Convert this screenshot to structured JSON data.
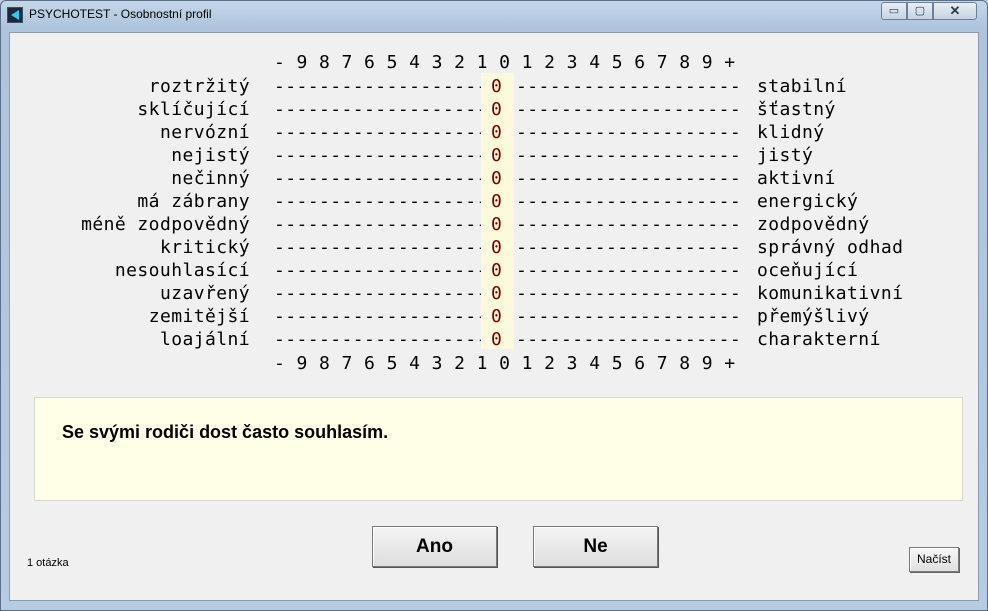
{
  "window": {
    "title": "PSYCHOTEST - Osobnostní profil",
    "controls": {
      "minimize": "▭",
      "maximize": "▢",
      "close": "✕"
    }
  },
  "scale": {
    "top": "- 9 8 7 6 5 4 3 2 1 0 1 2 3 4 5 6 7 8 9 +",
    "bottom": "- 9 8 7 6 5 4 3 2 1 0 1 2 3 4 5 6 7 8 9 +"
  },
  "rows": [
    {
      "left": "roztržitý",
      "dashes_left": "--------------------",
      "value": "0",
      "dashes_right": "--------------------",
      "right": "stabilní"
    },
    {
      "left": "sklíčující",
      "dashes_left": "--------------------",
      "value": "0",
      "dashes_right": "--------------------",
      "right": "šťastný"
    },
    {
      "left": "nervózní",
      "dashes_left": "--------------------",
      "value": "0",
      "dashes_right": "--------------------",
      "right": "klidný"
    },
    {
      "left": "nejistý",
      "dashes_left": "--------------------",
      "value": "0",
      "dashes_right": "--------------------",
      "right": "jistý"
    },
    {
      "left": "nečinný",
      "dashes_left": "--------------------",
      "value": "0",
      "dashes_right": "--------------------",
      "right": "aktivní"
    },
    {
      "left": "má zábrany",
      "dashes_left": "--------------------",
      "value": "0",
      "dashes_right": "--------------------",
      "right": "energický"
    },
    {
      "left": "méně zodpovědný",
      "dashes_left": "--------------------",
      "value": "0",
      "dashes_right": "--------------------",
      "right": "zodpovědný"
    },
    {
      "left": "kritický",
      "dashes_left": "--------------------",
      "value": "0",
      "dashes_right": "--------------------",
      "right": "správný odhad"
    },
    {
      "left": "nesouhlasící",
      "dashes_left": "--------------------",
      "value": "0",
      "dashes_right": "--------------------",
      "right": "oceňující"
    },
    {
      "left": "uzavřený",
      "dashes_left": "--------------------",
      "value": "0",
      "dashes_right": "--------------------",
      "right": "komunikativní"
    },
    {
      "left": "zemitější",
      "dashes_left": "--------------------",
      "value": "0",
      "dashes_right": "--------------------",
      "right": "přemýšlivý"
    },
    {
      "left": "loajální",
      "dashes_left": "--------------------",
      "value": "0",
      "dashes_right": "--------------------",
      "right": "charakterní"
    }
  ],
  "question": {
    "text": "Se svými rodiči dost často souhlasím."
  },
  "buttons": {
    "yes": "Ano",
    "no": "Ne",
    "load": "Načíst"
  },
  "status": {
    "counter": "1 otázka"
  },
  "colors": {
    "value_text": "#7a0000",
    "value_bg": "#fdf9dc",
    "question_bg": "#fffee6"
  }
}
